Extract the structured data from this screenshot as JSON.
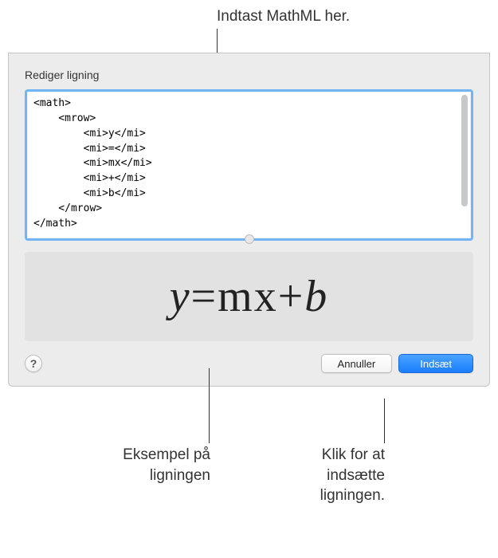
{
  "annotations": {
    "top": "Indtast MathML her.",
    "bottom_left": "Eksempel på ligningen",
    "bottom_right": "Klik for at indsætte ligningen."
  },
  "dialog": {
    "title": "Rediger ligning",
    "code": "<math>\n    <mrow>\n        <mi>y</mi>\n        <mi>=</mi>\n        <mi>mx</mi>\n        <mi>+</mi>\n        <mi>b</mi>\n    </mrow>\n</math>",
    "preview": {
      "y": "y",
      "eq": "=",
      "mx": "mx",
      "plus": "+",
      "b": "b"
    },
    "help_symbol": "?",
    "cancel_label": "Annuller",
    "insert_label": "Indsæt"
  }
}
